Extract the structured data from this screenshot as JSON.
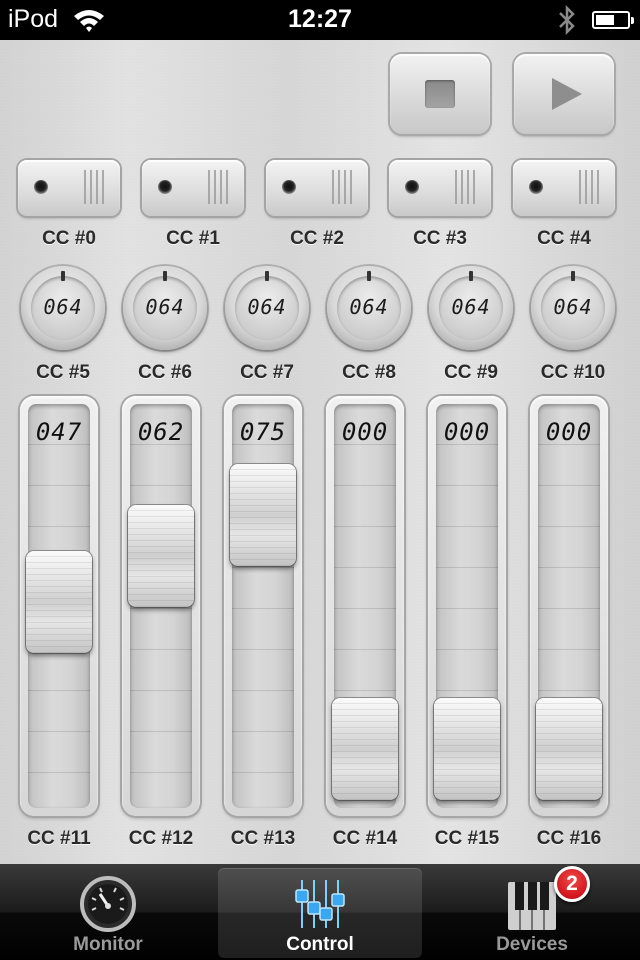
{
  "status_bar": {
    "carrier": "iPod",
    "time": "12:27",
    "battery_level": 0.6
  },
  "transport": {
    "stop_icon": "stop-icon",
    "play_icon": "play-icon"
  },
  "toggles": [
    {
      "label": "CC #0"
    },
    {
      "label": "CC #1"
    },
    {
      "label": "CC #2"
    },
    {
      "label": "CC #3"
    },
    {
      "label": "CC #4"
    }
  ],
  "knobs": [
    {
      "label": "CC #5",
      "value": "064"
    },
    {
      "label": "CC #6",
      "value": "064"
    },
    {
      "label": "CC #7",
      "value": "064"
    },
    {
      "label": "CC #8",
      "value": "064"
    },
    {
      "label": "CC #9",
      "value": "064"
    },
    {
      "label": "CC #10",
      "value": "064"
    }
  ],
  "faders": [
    {
      "label": "CC #11",
      "value": "047"
    },
    {
      "label": "CC #12",
      "value": "062"
    },
    {
      "label": "CC #13",
      "value": "075"
    },
    {
      "label": "CC #14",
      "value": "000"
    },
    {
      "label": "CC #15",
      "value": "000"
    },
    {
      "label": "CC #16",
      "value": "000"
    }
  ],
  "fader_max": 127,
  "tabs": [
    {
      "label": "Monitor",
      "icon": "speedometer-icon",
      "active": false
    },
    {
      "label": "Control",
      "icon": "mixer-sliders-icon",
      "active": true
    },
    {
      "label": "Devices",
      "icon": "piano-keys-icon",
      "active": false,
      "badge": "2"
    }
  ]
}
